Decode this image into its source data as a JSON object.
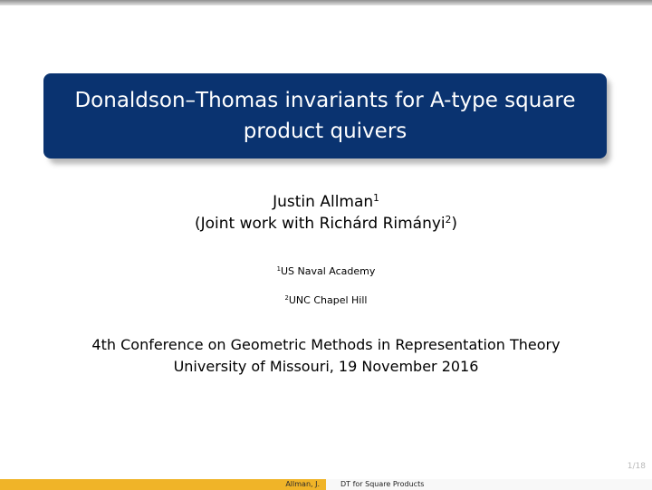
{
  "slide": {
    "title": "Donaldson–Thomas invariants for A-type square product quivers",
    "author": "Justin Allman",
    "author_affil_mark": "1",
    "joint_prefix": "(Joint work with Richárd Rimányi",
    "joint_affil_mark": "2",
    "joint_suffix": ")",
    "institutions": [
      {
        "mark": "1",
        "name": "US Naval Academy"
      },
      {
        "mark": "2",
        "name": "UNC Chapel Hill"
      }
    ],
    "conference": "4th Conference on Geometric Methods in Representation Theory",
    "venue_date": "University of Missouri, 19 November 2016",
    "page_number": "1/18"
  },
  "footer": {
    "short_author": "Allman, J.",
    "short_title": "DT for Square Products"
  },
  "colors": {
    "title_box": "#0a3370",
    "footer_left": "#f0b428",
    "footer_right": "#f8f8f8"
  }
}
